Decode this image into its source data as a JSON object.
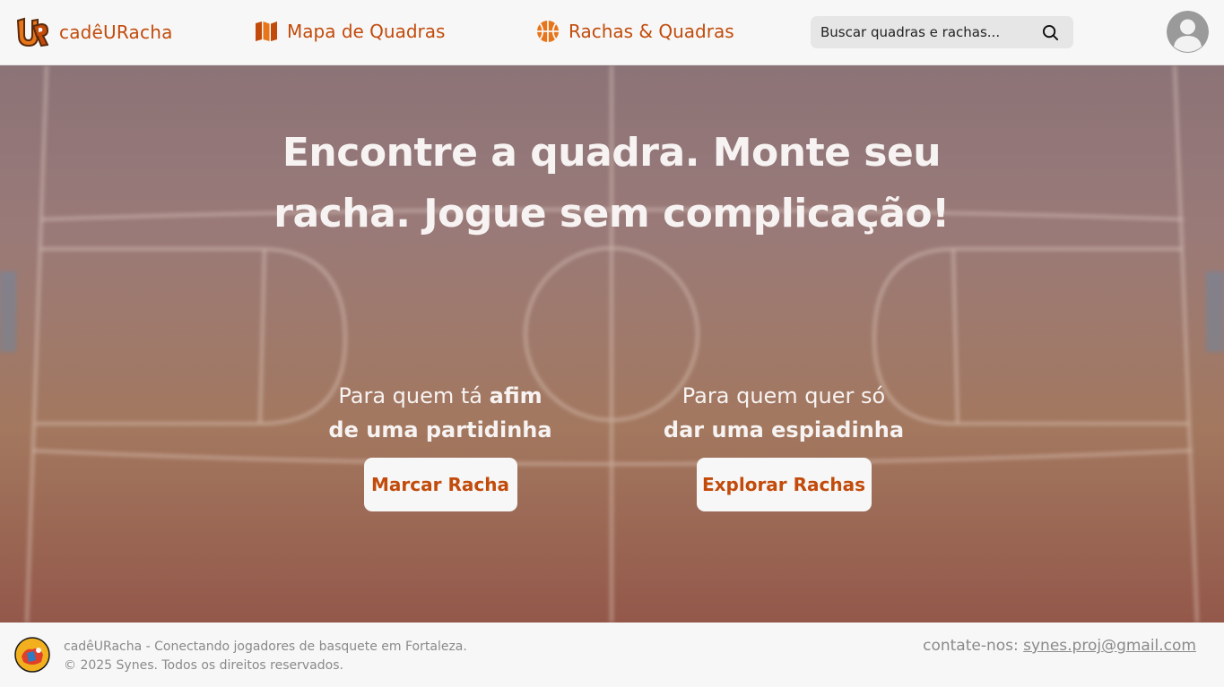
{
  "header": {
    "brand_name": "cadêURacha",
    "nav": [
      {
        "label": "Mapa de Quadras",
        "icon": "map-icon"
      },
      {
        "label": "Rachas & Quadras",
        "icon": "basketball-icon"
      }
    ],
    "search": {
      "placeholder": "Buscar quadras e rachas...",
      "icon": "search-icon"
    },
    "avatar_icon": "user-avatar-icon"
  },
  "hero": {
    "title": "Encontre a quadra. Monte seu racha. Jogue sem complicação!",
    "left": {
      "line1_normal": "Para quem tá ",
      "line1_bold": "afim",
      "line2": "de uma partidinha",
      "button": "Marcar Racha"
    },
    "right": {
      "line1": "Para quem quer só",
      "line2": "dar uma espiadinha",
      "button": "Explorar Rachas"
    }
  },
  "footer": {
    "tagline": "cadêURacha - Conectando jogadores de basquete em Fortaleza.",
    "copyright": "© 2025 Synes. Todos os direitos reservados.",
    "contact_label": "contate-nos: ",
    "contact_email": "synes.proj@gmail.com"
  },
  "colors": {
    "accent": "#c24b0b",
    "header_bg": "#f7f7f7",
    "footer_text": "#8a8a8a"
  }
}
